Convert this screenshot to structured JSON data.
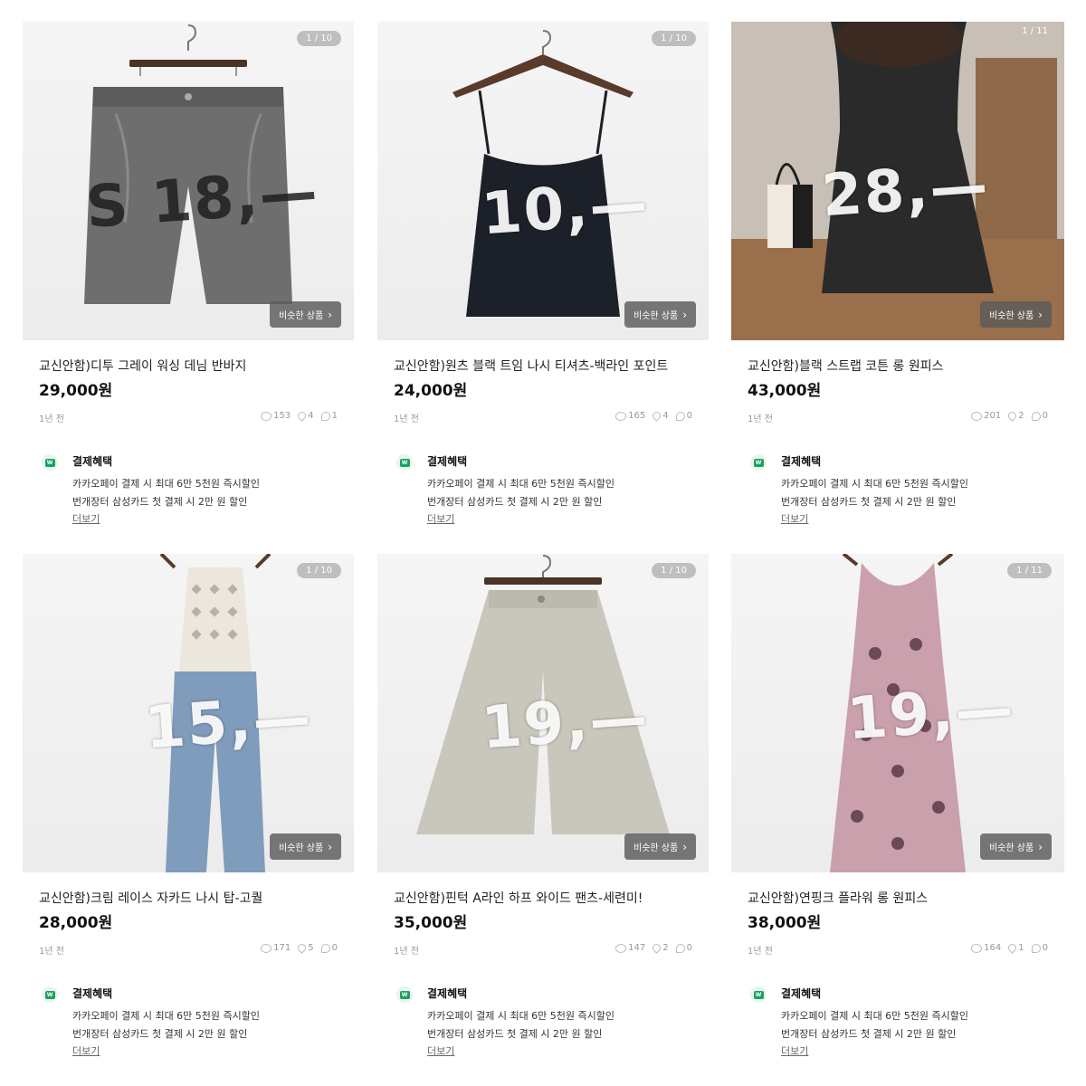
{
  "similar_label": "비슷한 상품",
  "benefit": {
    "title": "결제혜택",
    "line1": "카카오페이 결제 시 최대 6만 5천원 즉시할인",
    "line2": "번개장터 삼성카드 첫 결제 시 2만 원  할인",
    "more": "더보기"
  },
  "products": [
    {
      "counter": "1 / 10",
      "scribble": "S 18,—",
      "title": "교신안함)디투 그레이 워싱 데님 반바지",
      "price": "29,000원",
      "time": "1년 전",
      "views": "153",
      "likes": "4",
      "chats": "1"
    },
    {
      "counter": "1 / 10",
      "scribble": "10,—",
      "title": "교신안함)원츠 블랙 트임 나시 티셔츠-백라인 포인트",
      "price": "24,000원",
      "time": "1년 전",
      "views": "165",
      "likes": "4",
      "chats": "0"
    },
    {
      "counter": "1 / 11",
      "scribble": "28,—",
      "title": "교신안함)블랙 스트랩 코튼 롱 원피스",
      "price": "43,000원",
      "time": "1년 전",
      "views": "201",
      "likes": "2",
      "chats": "0"
    },
    {
      "counter": "1 / 10",
      "scribble": "15,—",
      "title": "교신안함)크림 레이스 자카드 나시 탑-고퀄",
      "price": "28,000원",
      "time": "1년 전",
      "views": "171",
      "likes": "5",
      "chats": "0"
    },
    {
      "counter": "1 / 10",
      "scribble": "19,—",
      "title": "교신안함)핀턱 A라인 하프 와이드 팬츠-세련미!",
      "price": "35,000원",
      "time": "1년 전",
      "views": "147",
      "likes": "2",
      "chats": "0"
    },
    {
      "counter": "1 / 11",
      "scribble": "19,—",
      "title": "교신안함)연핑크 플라워 롱 원피스",
      "price": "38,000원",
      "time": "1년 전",
      "views": "164",
      "likes": "1",
      "chats": "0"
    }
  ],
  "colors": {
    "benefit_green": "#1aa260",
    "denim_gray": "#6e6e6e",
    "black_top": "#1c2028",
    "cream_lace": "#ebe7dc",
    "jeans_blue": "#7f9cbc",
    "beige_pants": "#c9c7bb",
    "pink_dress": "#c9a0ab"
  }
}
